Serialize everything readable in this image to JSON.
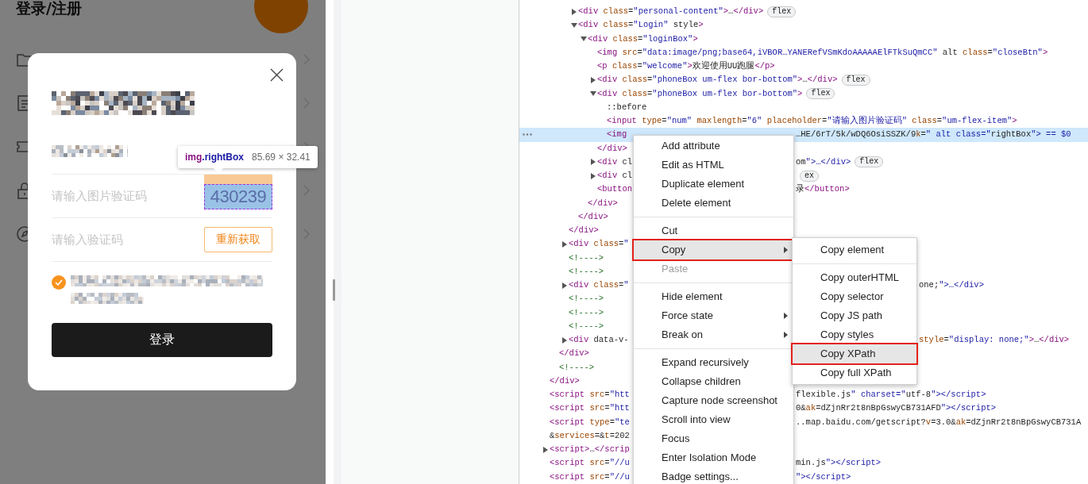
{
  "device_page": {
    "title": "登录/注册"
  },
  "login_dialog": {
    "captcha_field": {
      "placeholder": "请输入图片验证码",
      "captcha_text": "430239"
    },
    "code_field": {
      "placeholder": "请输入验证码",
      "resend_button": "重新获取"
    },
    "agreement": {
      "checked": true
    },
    "login_button": "登录"
  },
  "inspect_tooltip": {
    "selector": "img.rightBox",
    "size": "85.69 × 32.41"
  },
  "elements_tree": [
    {
      "children": [
        {
          "children": [
            {
              "children": [
                {
                  "code": "<div class=\"personal-content\">…</div>",
                  "expanded": false,
                  "badge": "flex",
                  "selected": false
                },
                {
                  "code": "<div class=\"Login\" style>",
                  "expanded": true,
                  "selected": false,
                  "children": [
                    {
                      "code": "<div class=\"loginBox\">",
                      "expanded": true,
                      "selected": false,
                      "children": [
                        {
                          "code": "<img src=\"data:image/png;base64,iVBOR…YANERefVSmKdoAAAAAElFTkSuQmCC\" alt class=\"closeBtn\">",
                          "selected": false
                        },
                        {
                          "code": "<p class=\"welcome\">欢迎使用UU跑腿</p>",
                          "selected": false
                        },
                        {
                          "code": "<div class=\"phoneBox um-flex bor-bottom\">…</div>",
                          "expanded": false,
                          "badge": "flex",
                          "selected": false
                        },
                        {
                          "code": "<div class=\"phoneBox um-flex bor-bottom\">",
                          "expanded": true,
                          "badge": "flex",
                          "selected": false,
                          "children": [
                            {
                              "code": "::before",
                              "selected": false
                            },
                            {
                              "code": "<input type=\"num\" maxlength=\"6\" placeholder=\"请输入图片验证码\" class=\"um-flex-item\">",
                              "selected": false
                            },
                            {
                              "code": "<img",
                              "tail": {
                                "code": "…HE/6rT/5k/wDQ6OsiSSZK/9k=\" alt class=\"rightBox\"> == $0"
                              },
                              "selected": true
                            }
                          ]
                        },
                        {
                          "code": "</div>",
                          "selected": false
                        },
                        {
                          "code": "<div cl",
                          "expanded": false,
                          "tail": {
                            "code": "om\">…</div>",
                            "badge": "flex"
                          },
                          "selected": false
                        },
                        {
                          "code": "<div cl",
                          "expanded": false,
                          "tail": {
                            "badge": "ex"
                          },
                          "selected": false
                        },
                        {
                          "code": "<button",
                          "tail": {
                            "code": "录</button>"
                          },
                          "selected": false
                        }
                      ]
                    },
                    {
                      "code": "</div>",
                      "selected": false
                    }
                  ]
                },
                {
                  "code": "</div>",
                  "selected": false
                }
              ]
            },
            {
              "code": "</div>",
              "selected": false
            },
            {
              "code": "<div class=\"",
              "expanded": false,
              "selected": false
            },
            {
              "code": "<!---->",
              "selected": false
            },
            {
              "code": "<!---->",
              "selected": false
            },
            {
              "code": "<div class=\"",
              "expanded": false,
              "tail": {
                "code": "one;\">…</div>"
              },
              "selected": false
            },
            {
              "code": "<!---->",
              "selected": false
            },
            {
              "code": "<!---->",
              "selected": false
            },
            {
              "code": "<!---->",
              "selected": false
            },
            {
              "code": "<div data-v-",
              "expanded": false,
              "tail": {
                "code": "style=\"display: none;\">…</div>"
              },
              "selected": false
            }
          ]
        },
        {
          "code": "</div>",
          "selected": false
        },
        {
          "code": "<!---->",
          "selected": false
        }
      ]
    },
    {
      "code": "</div>",
      "selected": false
    },
    {
      "code": "<script src=\"htt",
      "tail": {
        "code": "flexible.js\" charset=\"utf-8\"></script>"
      },
      "selected": false
    },
    {
      "code": "<script src=\"htt",
      "tail": {
        "code": "0&ak=dZjnRr2t8nBpGswyCB731AFD\"></script>"
      },
      "selected": false
    },
    {
      "code": "<script type=\"te",
      "tail": {
        "code": "..map.baidu.com/getscript?v=3.0&ak=dZjnRr2t8nBpGswyCB731A"
      },
      "selected": false
    },
    {
      "code": "&services=&t=202",
      "selected": false
    },
    {
      "code": "<script>…</scrip",
      "expanded": false,
      "selected": false
    },
    {
      "code": "<script src=\"//u",
      "tail": {
        "code": "min.js\"></script>"
      },
      "selected": false
    },
    {
      "code": "<script src=\"//u",
      "tail": {
        "code": "\"></script>"
      },
      "selected": false
    }
  ],
  "context_menu": {
    "items": [
      {
        "kind": "item",
        "label": "Add attribute",
        "has_submenu": false,
        "disabled": false,
        "selected": false,
        "marked": false
      },
      {
        "kind": "item",
        "label": "Edit as HTML",
        "has_submenu": false,
        "disabled": false,
        "selected": false,
        "marked": false
      },
      {
        "kind": "item",
        "label": "Duplicate element",
        "has_submenu": false,
        "disabled": false,
        "selected": false,
        "marked": false
      },
      {
        "kind": "item",
        "label": "Delete element",
        "has_submenu": false,
        "disabled": false,
        "selected": false,
        "marked": false
      },
      {
        "kind": "separator"
      },
      {
        "kind": "item",
        "label": "Cut",
        "has_submenu": false,
        "disabled": false,
        "selected": false,
        "marked": false
      },
      {
        "kind": "item",
        "label": "Copy",
        "has_submenu": true,
        "disabled": false,
        "selected": true,
        "marked": true
      },
      {
        "kind": "item",
        "label": "Paste",
        "has_submenu": false,
        "disabled": true,
        "selected": false,
        "marked": false
      },
      {
        "kind": "separator"
      },
      {
        "kind": "item",
        "label": "Hide element",
        "has_submenu": false,
        "disabled": false,
        "selected": false,
        "marked": false
      },
      {
        "kind": "item",
        "label": "Force state",
        "has_submenu": true,
        "disabled": false,
        "selected": false,
        "marked": false
      },
      {
        "kind": "item",
        "label": "Break on",
        "has_submenu": true,
        "disabled": false,
        "selected": false,
        "marked": false
      },
      {
        "kind": "separator"
      },
      {
        "kind": "item",
        "label": "Expand recursively",
        "has_submenu": false,
        "disabled": false,
        "selected": false,
        "marked": false
      },
      {
        "kind": "item",
        "label": "Collapse children",
        "has_submenu": false,
        "disabled": false,
        "selected": false,
        "marked": false
      },
      {
        "kind": "item",
        "label": "Capture node screenshot",
        "has_submenu": false,
        "disabled": false,
        "selected": false,
        "marked": false
      },
      {
        "kind": "item",
        "label": "Scroll into view",
        "has_submenu": false,
        "disabled": false,
        "selected": false,
        "marked": false
      },
      {
        "kind": "item",
        "label": "Focus",
        "has_submenu": false,
        "disabled": false,
        "selected": false,
        "marked": false
      },
      {
        "kind": "item",
        "label": "Enter Isolation Mode",
        "has_submenu": false,
        "disabled": false,
        "selected": false,
        "marked": false
      },
      {
        "kind": "item",
        "label": "Badge settings...",
        "has_submenu": false,
        "disabled": false,
        "selected": false,
        "marked": false
      }
    ]
  },
  "copy_submenu": {
    "items": [
      {
        "kind": "item",
        "label": "Copy element",
        "has_submenu": false,
        "disabled": false,
        "selected": false,
        "marked": false
      },
      {
        "kind": "separator"
      },
      {
        "kind": "item",
        "label": "Copy outerHTML",
        "has_submenu": false,
        "disabled": false,
        "selected": false,
        "marked": false
      },
      {
        "kind": "item",
        "label": "Copy selector",
        "has_submenu": false,
        "disabled": false,
        "selected": false,
        "marked": false
      },
      {
        "kind": "item",
        "label": "Copy JS path",
        "has_submenu": false,
        "disabled": false,
        "selected": false,
        "marked": false
      },
      {
        "kind": "item",
        "label": "Copy styles",
        "has_submenu": false,
        "disabled": false,
        "selected": false,
        "marked": false
      },
      {
        "kind": "item",
        "label": "Copy XPath",
        "has_submenu": false,
        "disabled": false,
        "selected": true,
        "marked": true
      },
      {
        "kind": "item",
        "label": "Copy full XPath",
        "has_submenu": false,
        "disabled": false,
        "selected": false,
        "marked": false
      }
    ]
  }
}
